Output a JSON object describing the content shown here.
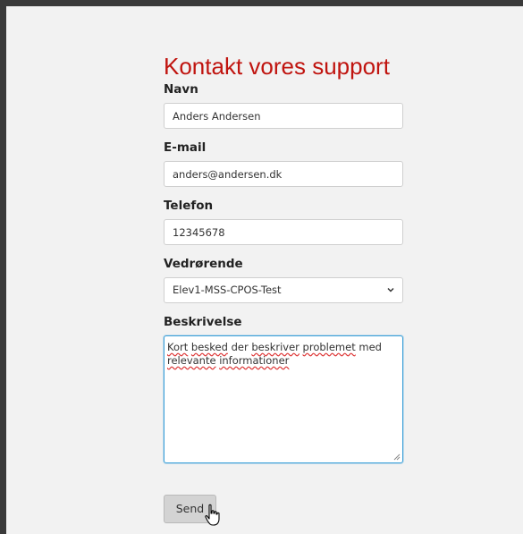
{
  "form": {
    "title": "Kontakt vores support",
    "name_label": "Navn",
    "name_value": "Anders Andersen",
    "email_label": "E-mail",
    "email_value": "anders@andersen.dk",
    "phone_label": "Telefon",
    "phone_value": "12345678",
    "subject_label": "Vedrørende",
    "subject_value": "Elev1-MSS-CPOS-Test",
    "description_label": "Beskrivelse",
    "description_words": [
      "Kort",
      "besked",
      "der",
      "beskriver",
      "problemet",
      "med",
      "relevante",
      "informationer"
    ],
    "send_label": "Send"
  },
  "icons": {
    "select_arrow": "chevron-down-icon",
    "cursor": "hand-pointer-cursor-icon",
    "resize": "resize-handle-icon"
  },
  "colors": {
    "title": "#c0140f",
    "focus_border": "#3b9fd8",
    "button_bg": "#d3d3d3",
    "page_bg": "#f2f2f2",
    "frame": "#3a3a3a"
  }
}
